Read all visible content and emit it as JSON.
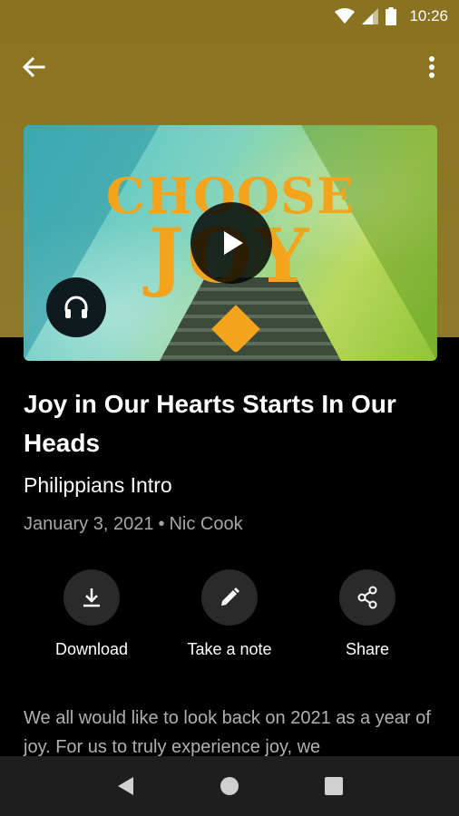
{
  "status_bar": {
    "time": "10:26",
    "icons": [
      "wifi-icon",
      "signal-icon",
      "battery-icon"
    ]
  },
  "app_bar": {
    "back_icon": "arrow-left-icon",
    "menu_icon": "more-vert-icon"
  },
  "hero": {
    "artwork_line_1": "CHOOSE",
    "artwork_line_2": "JOY",
    "play_icon": "play-icon",
    "audio_icon": "headphones-icon",
    "accent_color": "#f2a51c"
  },
  "sermon": {
    "title": "Joy in Our Hearts Starts In Our Heads",
    "series": "Philippians Intro",
    "date": "January 3, 2021",
    "separator": "•",
    "speaker": "Nic Cook"
  },
  "actions": [
    {
      "label": "Download",
      "icon": "download-icon"
    },
    {
      "label": "Take a note",
      "icon": "pencil-icon"
    },
    {
      "label": "Share",
      "icon": "share-icon"
    }
  ],
  "description": "We all would like to look back on 2021 as a year of joy. For us to truly experience joy, we",
  "nav_bar": {
    "icons": [
      "back-triangle-icon",
      "home-circle-icon",
      "recents-square-icon"
    ]
  },
  "colors": {
    "header_bg": "#8a7320",
    "background": "#000000",
    "action_circle": "#2a2a2a"
  }
}
